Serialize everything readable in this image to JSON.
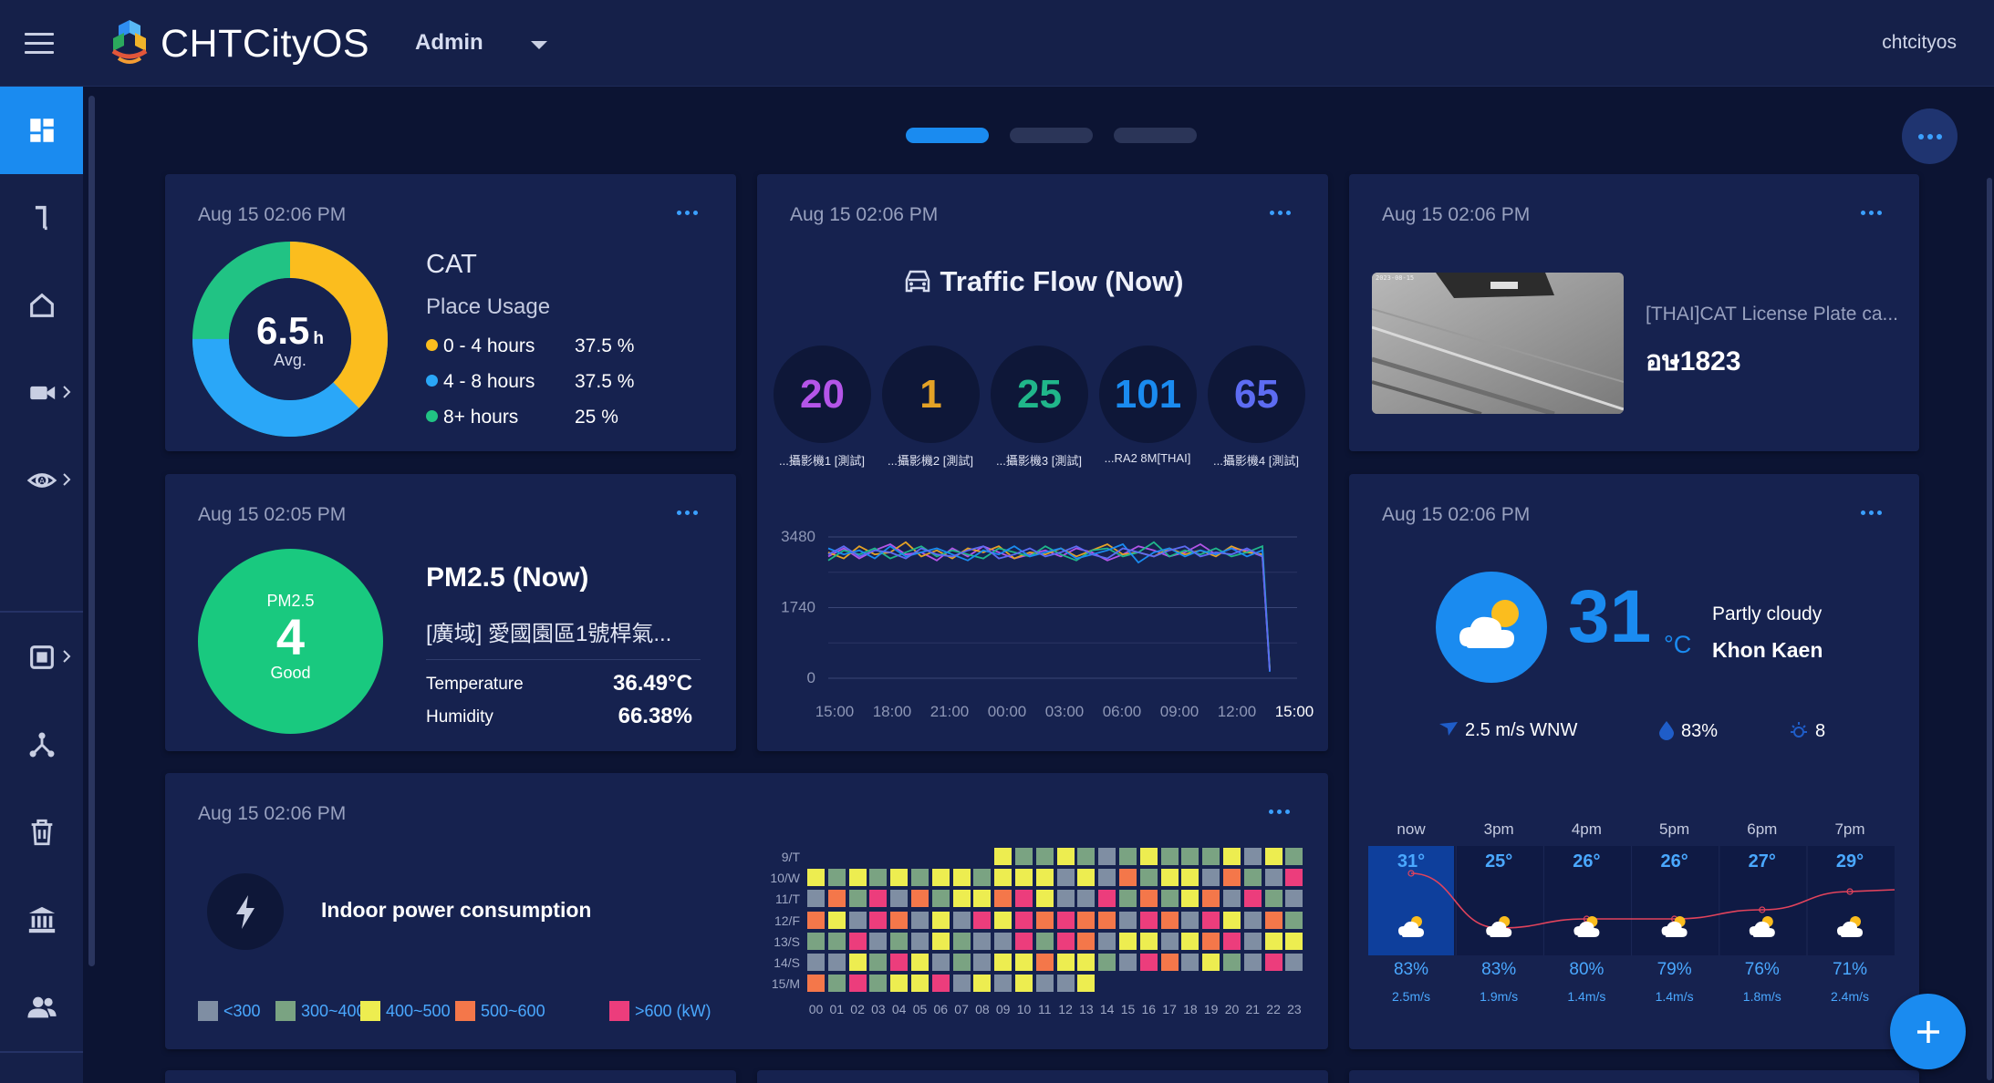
{
  "header": {
    "brand": "CHTCityOS",
    "role": "Admin",
    "username": "chtcityos"
  },
  "colors": {
    "accent": "#1a8bf0",
    "background": "#0c1433",
    "card": "#16224f",
    "good": "#19c97f"
  },
  "sidebar": {
    "items": [
      {
        "icon": "dashboard-icon",
        "active": true
      },
      {
        "icon": "hook-icon"
      },
      {
        "icon": "home-icon"
      },
      {
        "icon": "video-camera-icon",
        "expandable": true
      },
      {
        "icon": "radar-eye-icon",
        "expandable": true
      },
      {
        "icon": "chip-icon",
        "expandable": true
      },
      {
        "icon": "network-icon"
      },
      {
        "icon": "trash-icon"
      },
      {
        "icon": "bank-icon"
      },
      {
        "icon": "users-icon"
      }
    ]
  },
  "cat": {
    "time": "Aug 15 02:06 PM",
    "title": "CAT",
    "subtitle": "Place Usage",
    "avg_value": "6.5",
    "avg_unit": "h",
    "avg_label": "Avg.",
    "legend": [
      {
        "label": "0 - 4 hours",
        "value": "37.5 %",
        "color": "#fbbd1e"
      },
      {
        "label": "4 - 8 hours",
        "value": "37.5 %",
        "color": "#2aa7f8"
      },
      {
        "label": "8+ hours",
        "value": "25 %",
        "color": "#21c384"
      }
    ]
  },
  "traffic": {
    "time": "Aug 15 02:06 PM",
    "title": "Traffic Flow (Now)",
    "cameras": [
      {
        "value": "20",
        "label": "...攝影機1 [測試]",
        "color": "#b455e8"
      },
      {
        "value": "1",
        "label": "...攝影機2 [測試]",
        "color": "#e4a226"
      },
      {
        "value": "25",
        "label": "...攝影機3 [測試]",
        "color": "#20b68a"
      },
      {
        "value": "101",
        "label": "...RA2 8M[THAI]",
        "color": "#1a8bf0"
      },
      {
        "value": "65",
        "label": "...攝影機4 [測試]",
        "color": "#5d6cf2"
      }
    ],
    "chart_data": {
      "type": "line",
      "ylim": [
        0,
        3480
      ],
      "yticks": [
        "3480",
        "1740",
        "0"
      ],
      "xticks": [
        "15:00",
        "18:00",
        "21:00",
        "00:00",
        "03:00",
        "06:00",
        "09:00",
        "12:00",
        "15:00"
      ],
      "series": [
        {
          "color": "#b455e8",
          "values": [
            3000,
            3200,
            2950,
            3150,
            3300,
            3050,
            3100,
            2900,
            3200,
            3000,
            3250,
            3100,
            2950,
            3050,
            3150,
            3000,
            3200,
            3100,
            2900,
            3050,
            3250,
            3150,
            3000,
            3100,
            3300,
            3050,
            3200,
            3150,
            3000,
            200
          ]
        },
        {
          "color": "#e4a226",
          "values": [
            3100,
            2950,
            3250,
            3050,
            3100,
            3350,
            3000,
            3150,
            2950,
            3200,
            3100,
            3250,
            2950,
            3100,
            3050,
            3200,
            3000,
            3150,
            3300,
            3050,
            3100,
            3000,
            3200,
            3050,
            3150,
            3000,
            3250,
            3100,
            3050,
            250
          ]
        },
        {
          "color": "#20b68a",
          "values": [
            2900,
            3150,
            3050,
            3200,
            2950,
            3100,
            3250,
            3000,
            3150,
            3050,
            2950,
            3200,
            3100,
            3000,
            3250,
            3050,
            2900,
            3150,
            3200,
            3000,
            3100,
            3350,
            3000,
            3150,
            3050,
            3200,
            3000,
            3100,
            3250,
            220
          ]
        },
        {
          "color": "#1a8bf0",
          "values": [
            3200,
            3050,
            3150,
            2950,
            3250,
            3000,
            3100,
            3200,
            3050,
            2900,
            3150,
            3050,
            3250,
            3000,
            3100,
            3200,
            2950,
            3050,
            3150,
            3300,
            2850,
            3100,
            3200,
            3000,
            3150,
            3050,
            3200,
            3000,
            3150,
            160
          ]
        },
        {
          "color": "#5d6cf2",
          "values": [
            3050,
            3250,
            3000,
            3150,
            3100,
            2950,
            3200,
            3050,
            3000,
            3150,
            3250,
            2950,
            3050,
            3200,
            3000,
            3100,
            3250,
            3050,
            2950,
            3200,
            3100,
            3000,
            3150,
            3250,
            3000,
            3100,
            3050,
            3200,
            3000,
            180
          ]
        }
      ]
    }
  },
  "plate": {
    "time": "Aug 15 02:06 PM",
    "camera": "[THAI]CAT License Plate ca...",
    "plate_number": "อษ1823"
  },
  "pm": {
    "time": "Aug 15 02:05 PM",
    "circle_label": "PM2.5",
    "value": "4",
    "status": "Good",
    "title": "PM2.5 (Now)",
    "site": "[廣域] 愛國園區1號桿氣...",
    "rows": [
      {
        "label": "Temperature",
        "value": "36.49°C"
      },
      {
        "label": "Humidity",
        "value": "66.38%"
      }
    ]
  },
  "weather": {
    "time": "Aug 15 02:06 PM",
    "temp": "31",
    "unit": "°C",
    "desc": "Partly cloudy",
    "city": "Khon Kaen",
    "wind": "2.5 m/s WNW",
    "humidity": "83%",
    "uv": "8",
    "hourly": [
      {
        "label": "now",
        "temp": "31°",
        "humidity": "83%",
        "wind": "2.5m/s",
        "t": 31
      },
      {
        "label": "3pm",
        "temp": "25°",
        "humidity": "83%",
        "wind": "1.9m/s",
        "t": 25
      },
      {
        "label": "4pm",
        "temp": "26°",
        "humidity": "80%",
        "wind": "1.4m/s",
        "t": 26
      },
      {
        "label": "5pm",
        "temp": "26°",
        "humidity": "79%",
        "wind": "1.4m/s",
        "t": 26
      },
      {
        "label": "6pm",
        "temp": "27°",
        "humidity": "76%",
        "wind": "1.8m/s",
        "t": 27
      },
      {
        "label": "7pm",
        "temp": "29°",
        "humidity": "71%",
        "wind": "2.4m/s",
        "t": 29
      }
    ]
  },
  "power": {
    "time": "Aug 15 02:06 PM",
    "title": "Indoor power consumption",
    "legend": [
      {
        "label": "<300",
        "color": "#7f8ea3"
      },
      {
        "label": "300~400",
        "color": "#7aa382"
      },
      {
        "label": "400~500",
        "color": "#eded50"
      },
      {
        "label": "500~600",
        "color": "#f4774a"
      },
      {
        "label": ">600 (kW)",
        "color": "#ec3d7c"
      }
    ],
    "days": [
      "9/T",
      "10/W",
      "11/T",
      "12/F",
      "13/S",
      "14/S",
      "15/M"
    ],
    "hours": [
      "00",
      "01",
      "02",
      "03",
      "04",
      "05",
      "06",
      "07",
      "08",
      "09",
      "10",
      "11",
      "12",
      "13",
      "14",
      "15",
      "16",
      "17",
      "18",
      "19",
      "20",
      "21",
      "22",
      "23"
    ],
    "levels": [
      [
        null,
        null,
        null,
        null,
        null,
        null,
        null,
        null,
        null,
        2,
        1,
        1,
        2,
        1,
        0,
        1,
        2,
        1,
        1,
        1,
        2,
        0,
        2,
        1
      ],
      [
        2,
        1,
        2,
        1,
        2,
        1,
        2,
        2,
        1,
        2,
        2,
        2,
        0,
        2,
        0,
        3,
        1,
        2,
        2,
        0,
        3,
        1,
        0,
        4
      ],
      [
        0,
        3,
        1,
        4,
        0,
        3,
        1,
        2,
        2,
        3,
        4,
        2,
        0,
        0,
        4,
        1,
        3,
        1,
        2,
        3,
        0,
        4,
        1,
        0
      ],
      [
        3,
        2,
        0,
        4,
        3,
        0,
        2,
        0,
        4,
        2,
        4,
        3,
        4,
        3,
        3,
        0,
        4,
        3,
        0,
        4,
        2,
        0,
        3,
        1
      ],
      [
        1,
        1,
        4,
        0,
        1,
        0,
        2,
        1,
        0,
        0,
        4,
        1,
        4,
        3,
        0,
        2,
        2,
        0,
        2,
        3,
        4,
        0,
        2,
        2
      ],
      [
        0,
        0,
        2,
        1,
        4,
        2,
        0,
        1,
        0,
        2,
        2,
        3,
        2,
        2,
        1,
        0,
        4,
        3,
        0,
        2,
        1,
        0,
        4,
        0
      ],
      [
        3,
        1,
        4,
        1,
        2,
        2,
        4,
        0,
        2,
        0,
        2,
        0,
        0,
        2,
        null,
        null,
        null,
        null,
        null,
        null,
        null,
        null,
        null,
        null
      ]
    ]
  }
}
